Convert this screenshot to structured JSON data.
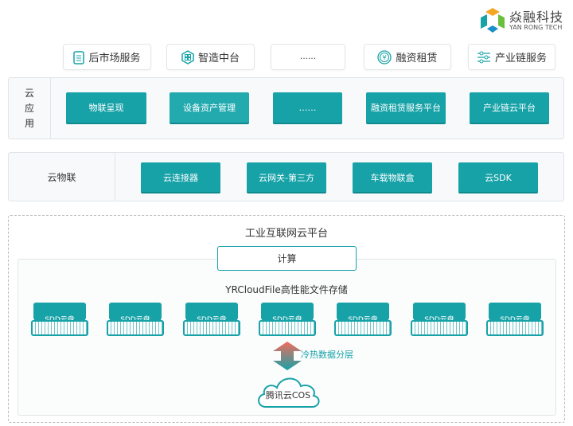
{
  "logo": {
    "name": "焱融科技",
    "subtitle": "YAN RONG TECH"
  },
  "services": [
    {
      "label": "后市场服务",
      "icon": "clipboard-icon"
    },
    {
      "label": "智造中台",
      "icon": "hexagon-grid-icon"
    },
    {
      "label": "……",
      "icon": ""
    },
    {
      "label": "融资租赁",
      "icon": "yen-coin-icon"
    },
    {
      "label": "产业链服务",
      "icon": "sliders-icon"
    }
  ],
  "cloud_app": {
    "label": "云应用",
    "items": [
      "物联呈现",
      "设备资产管理",
      "……",
      "融资租赁服务平台",
      "产业链云平台"
    ]
  },
  "cloud_iot": {
    "label": "云物联",
    "items": [
      "云连接器",
      "云网关-第三方",
      "车载物联盒",
      "云SDK"
    ]
  },
  "platform": {
    "title": "工业互联网云平台",
    "compute": "计算",
    "storage_title": "YRCloudFile高性能文件存储",
    "disks": [
      "SDD云盘",
      "SDD云盘",
      "SDD云盘",
      "SDD云盘",
      "SDD云盘",
      "SDD云盘",
      "SDD云盘"
    ],
    "tiering": "冷热数据分层",
    "cos": "腾讯云COS"
  },
  "colors": {
    "accent": "#17a2a8",
    "arrow_hot": "#f26b5b"
  }
}
